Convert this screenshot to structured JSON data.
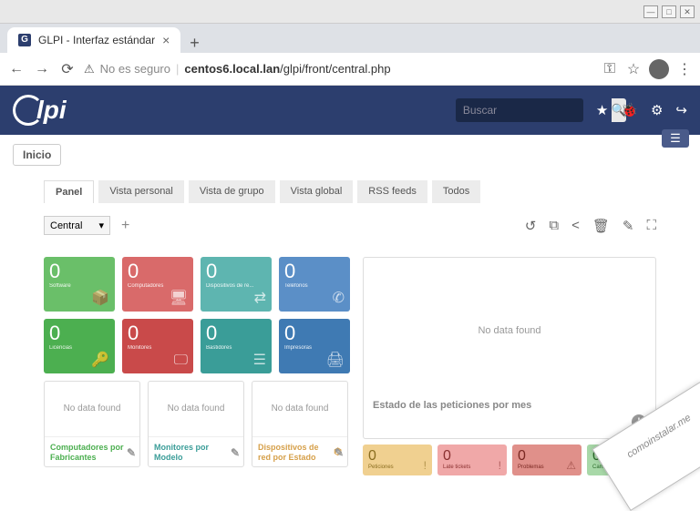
{
  "browser": {
    "tab_title": "GLPI - Interfaz estándar",
    "insecure_label": "No es seguro",
    "url_host": "centos6.local.lan",
    "url_path": "/glpi/front/central.php"
  },
  "header": {
    "logo_text": "lpi",
    "search_placeholder": "Buscar"
  },
  "breadcrumb": {
    "home": "Inicio"
  },
  "tabs": {
    "panel": "Panel",
    "vista_personal": "Vista personal",
    "vista_grupo": "Vista de grupo",
    "vista_global": "Vista global",
    "rss": "RSS feeds",
    "todos": "Todos"
  },
  "dashboard": {
    "selector_value": "Central",
    "no_data": "No data found"
  },
  "stats_row1": [
    {
      "value": "0",
      "label": "Software"
    },
    {
      "value": "0",
      "label": "Computadores"
    },
    {
      "value": "0",
      "label": "Dispositivos de re..."
    },
    {
      "value": "0",
      "label": "Teléfonos"
    }
  ],
  "stats_row2": [
    {
      "value": "0",
      "label": "Licencias"
    },
    {
      "value": "0",
      "label": "Monitores"
    },
    {
      "value": "0",
      "label": "Bastidores"
    },
    {
      "value": "0",
      "label": "Impresoras"
    }
  ],
  "charts": {
    "comp_fab": "Computadores por Fabricantes",
    "mon_mod": "Monitores por Modelo",
    "disp_red": "Dispositivos de red por Estado"
  },
  "right_chart": {
    "title": "Estado de las peticiones por mes"
  },
  "bottom_cards": [
    {
      "value": "0",
      "label": "Peticiones"
    },
    {
      "value": "0",
      "label": "Late tickets"
    },
    {
      "value": "0",
      "label": "Problemas"
    },
    {
      "value": "0",
      "label": "Cambios"
    }
  ],
  "watermark": "comoinstalar.me"
}
